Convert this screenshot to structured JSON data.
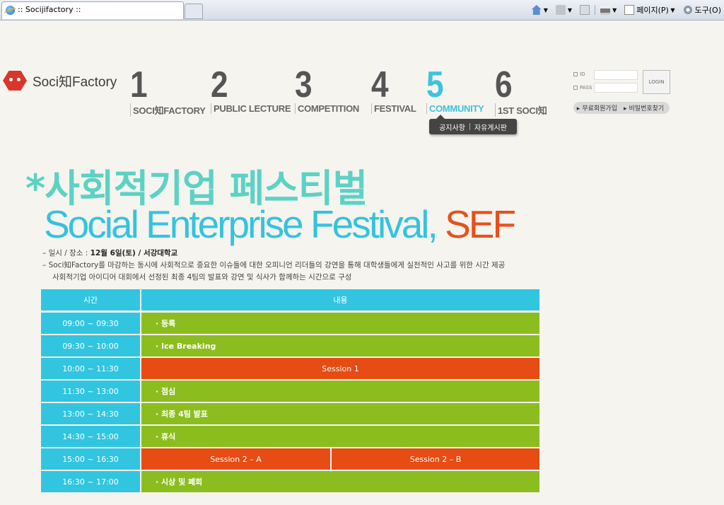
{
  "browser": {
    "tab_title": ":: Socijifactory ::",
    "page_menu": "페이지(P)",
    "tools_menu": "도구(O)"
  },
  "logo": {
    "text": "Soci知Factory"
  },
  "nav": [
    {
      "num": "1",
      "label": "SOCI知FACTORY"
    },
    {
      "num": "2",
      "label": "PUBLIC LECTURE"
    },
    {
      "num": "3",
      "label": "COMPETITION"
    },
    {
      "num": "4",
      "label": "FESTIVAL"
    },
    {
      "num": "5",
      "label": "COMMUNITY"
    },
    {
      "num": "6",
      "label": "1ST SOCI知"
    }
  ],
  "submenu": {
    "items": [
      "공지사항",
      "자유게시판"
    ]
  },
  "login": {
    "id_label": "ID",
    "pass_label": "PASS",
    "button": "LOGIN",
    "join": "무료회원가입",
    "find_pw": "비밀번호찾기"
  },
  "headline": {
    "asterisk": "*",
    "korean": "사회적기업 페스티벌",
    "english": "Social Enterprise Festival, ",
    "acronym": "SEF"
  },
  "description": {
    "line1_prefix": "– 일시 / 장소 : ",
    "line1_value": "12월 6일(토) / 서강대학교",
    "line2": "– Soci知Factory를 마감하는 동시에 사회적으로 중요한 이슈들에 대한 오피니언 리더들의 강연을 통해 대학생들에게 실천적인 사고를 위한 시간 제공",
    "line3": "사회적기업 아이디어 대회에서 선정된 최종 4팀의 발표와 강연 및 식사가 함께하는 시간으로 구성"
  },
  "schedule": {
    "col_time": "시간",
    "col_content": "내용",
    "rows": [
      {
        "time": "09:00 ~ 09:30",
        "content": "· 등록"
      },
      {
        "time": "09:30 ~ 10:00",
        "content": "· Ice Breaking"
      },
      {
        "time": "10:00 ~ 11:30",
        "content": "Session 1"
      },
      {
        "time": "11:30 ~ 13:00",
        "content": "· 점심"
      },
      {
        "time": "13:00 ~ 14:30",
        "content": "· 최종 4팀 발표"
      },
      {
        "time": "14:30 ~ 15:00",
        "content": "· 휴식"
      },
      {
        "time": "15:00 ~ 16:30",
        "content_a": "Session 2 – A",
        "content_b": "Session 2 – B"
      },
      {
        "time": "16:30 ~ 17:00",
        "content": "· 시상 및 폐회"
      }
    ]
  },
  "colors": {
    "accent_cyan": "#31c5e0",
    "green": "#8cbd1f",
    "orange": "#e64c14",
    "headline_mint": "#5cd2c4"
  }
}
